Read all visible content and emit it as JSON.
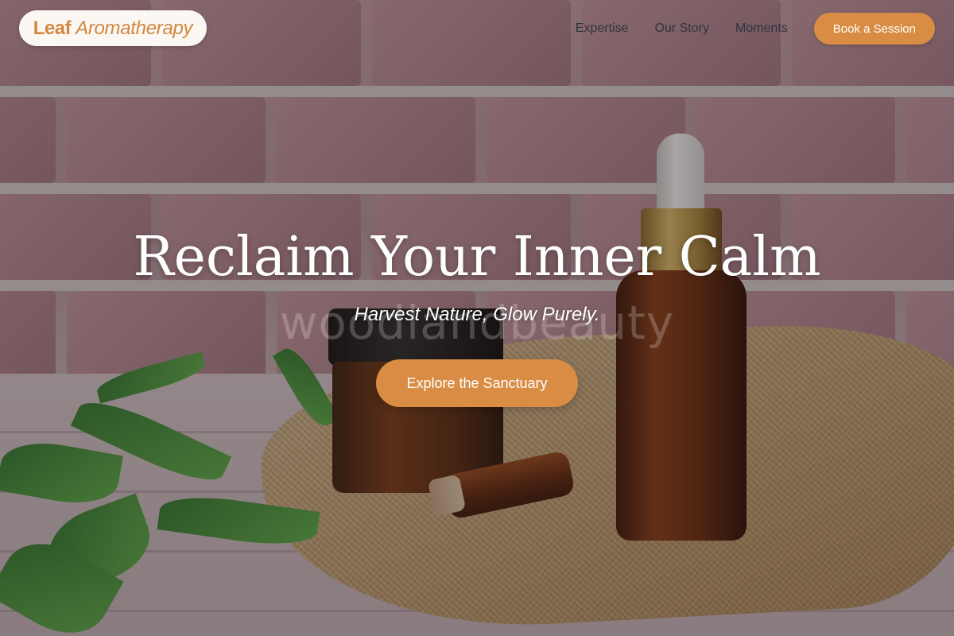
{
  "header": {
    "logo_strong": "Leaf",
    "logo_light": "Aromatherapy",
    "nav": [
      {
        "label": "Expertise"
      },
      {
        "label": "Our Story"
      },
      {
        "label": "Moments"
      }
    ],
    "cta_label": "Book a Session"
  },
  "hero": {
    "title": "Reclaim Your Inner Calm",
    "subtitle": "Harvest Nature, Glow Purely.",
    "cta_label": "Explore the Sanctuary",
    "watermark": "woodlandbeauty"
  },
  "colors": {
    "accent": "#d98d44",
    "logo_text": "#d2873e",
    "nav_text": "#2e3340",
    "hero_text": "#ffffff"
  },
  "icons": [
    "essential-oil-bottle-image"
  ]
}
